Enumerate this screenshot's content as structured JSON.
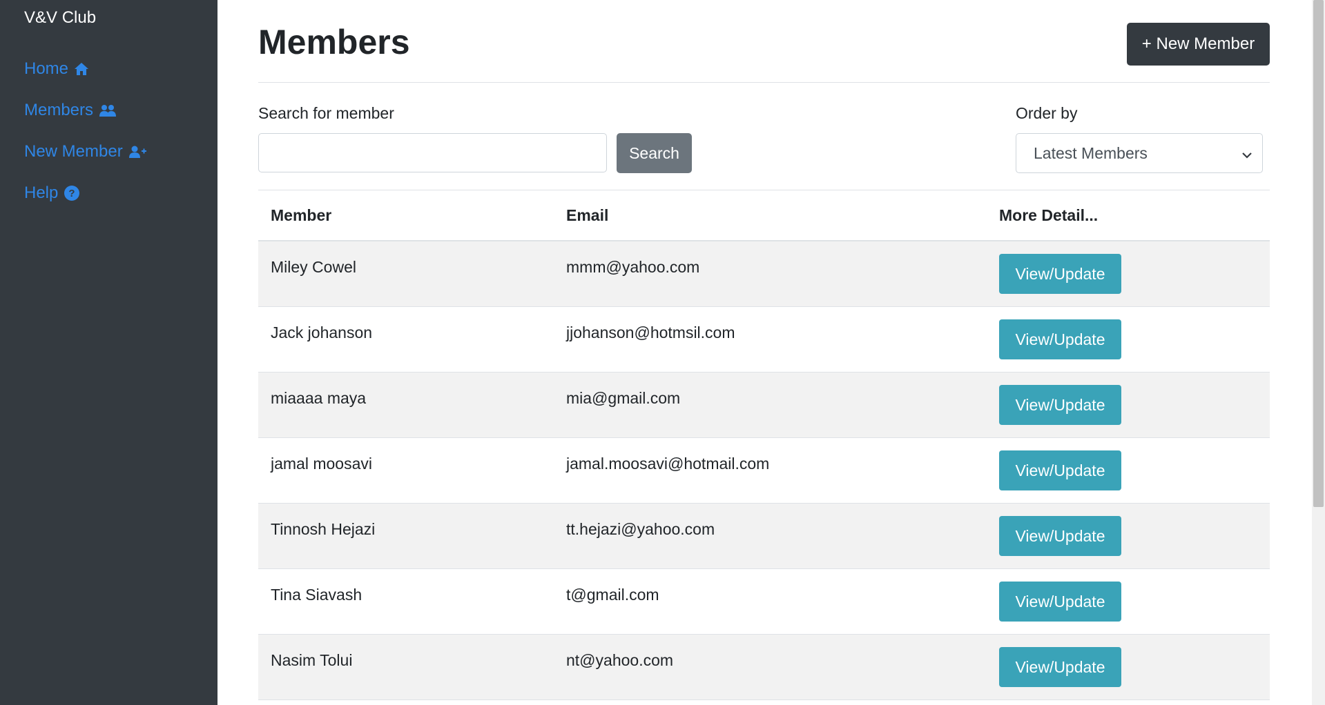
{
  "sidebar": {
    "brand": "V&V Club",
    "items": [
      {
        "label": "Home",
        "icon": "home-icon"
      },
      {
        "label": "Members",
        "icon": "users-icon"
      },
      {
        "label": "New Member",
        "icon": "user-plus-icon"
      },
      {
        "label": "Help",
        "icon": "question-circle-icon"
      }
    ]
  },
  "header": {
    "title": "Members",
    "new_member_label": "+ New Member"
  },
  "search": {
    "label": "Search for member",
    "value": "",
    "button_label": "Search"
  },
  "order": {
    "label": "Order by",
    "selected": "Latest Members"
  },
  "table": {
    "headers": [
      "Member",
      "Email",
      "More Detail..."
    ],
    "rows": [
      {
        "member": "Miley Cowel",
        "email": "mmm@yahoo.com",
        "action": "View/Update"
      },
      {
        "member": "Jack johanson",
        "email": "jjohanson@hotmsil.com",
        "action": "View/Update"
      },
      {
        "member": "miaaaa maya",
        "email": "mia@gmail.com",
        "action": "View/Update"
      },
      {
        "member": "jamal moosavi",
        "email": "jamal.moosavi@hotmail.com",
        "action": "View/Update"
      },
      {
        "member": "Tinnosh Hejazi",
        "email": "tt.hejazi@yahoo.com",
        "action": "View/Update"
      },
      {
        "member": "Tina Siavash",
        "email": "t@gmail.com",
        "action": "View/Update"
      },
      {
        "member": "Nasim Tolui",
        "email": "nt@yahoo.com",
        "action": "View/Update"
      }
    ]
  },
  "colors": {
    "sidebar_bg": "#343a40",
    "nav_link": "#2f86e6",
    "info_button": "#3aa3b8",
    "secondary_button": "#6c757d",
    "dark_button": "#343a40"
  }
}
